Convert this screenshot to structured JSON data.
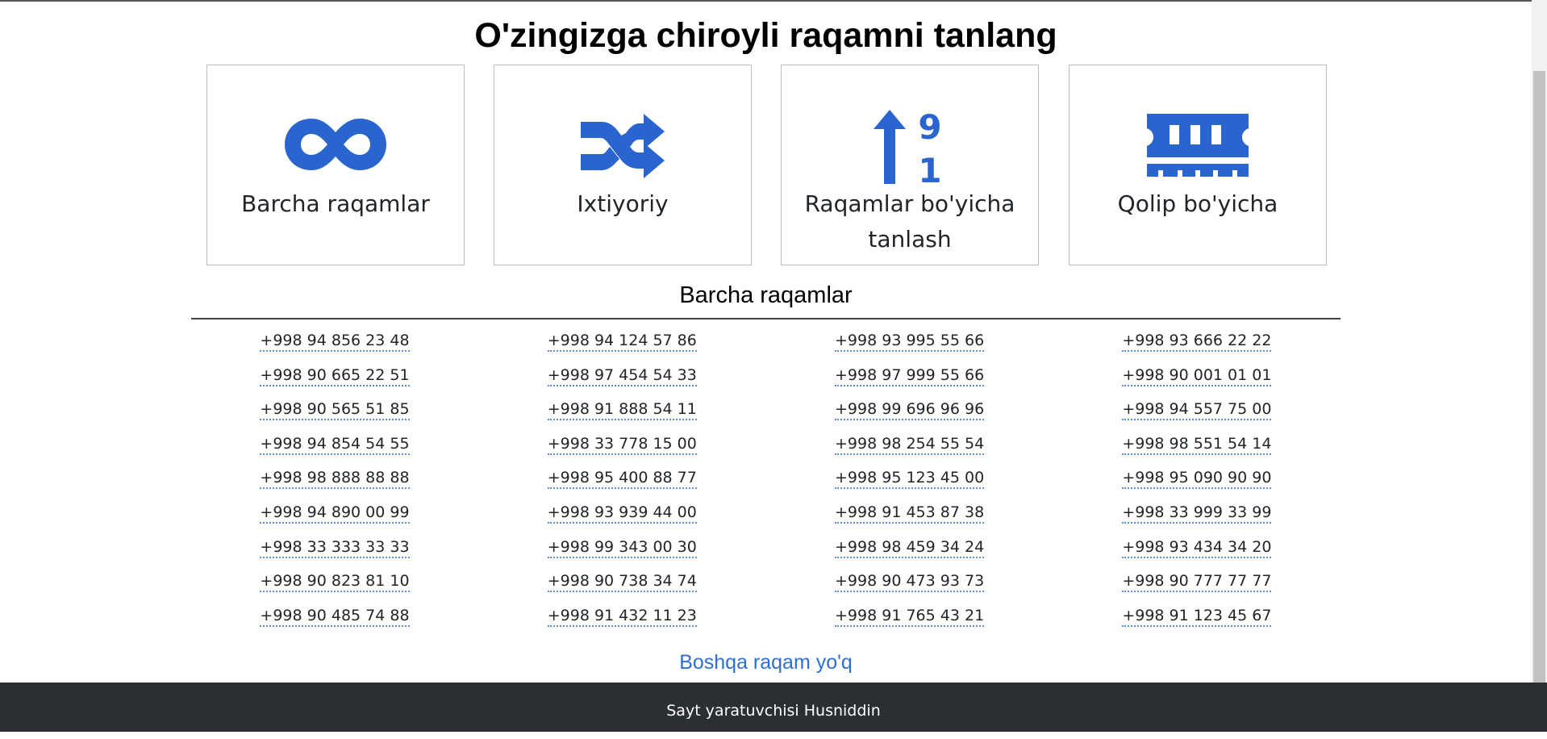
{
  "page": {
    "title": "O'zingizga chiroyli raqamni tanlang",
    "section_title": "Barcha raqamlar",
    "more_label": "Boshqa raqam yo'q",
    "footer_text": "Sayt yaratuvchisi Husniddin"
  },
  "colors": {
    "accent": "#2a65cf",
    "footer_bg": "#2b2e33",
    "link": "#2f6fd1"
  },
  "cards": [
    {
      "icon": "infinity-icon",
      "label": "Barcha raqamlar"
    },
    {
      "icon": "shuffle-icon",
      "label": "Ixtiyoriy"
    },
    {
      "icon": "sort-numeric-up-icon",
      "label": "Raqamlar bo'yicha tanlash"
    },
    {
      "icon": "memory-icon",
      "label": "Qolip bo'yicha"
    }
  ],
  "numbers": [
    [
      "+998 94 856 23 48",
      "+998 90 665 22 51",
      "+998 90 565 51 85",
      "+998 94 854 54 55",
      "+998 98 888 88 88",
      "+998 94 890 00 99",
      "+998 33 333 33 33",
      "+998 90 823 81 10",
      "+998 90 485 74 88"
    ],
    [
      "+998 94 124 57 86",
      "+998 97 454 54 33",
      "+998 91 888 54 11",
      "+998 33 778 15 00",
      "+998 95 400 88 77",
      "+998 93 939 44 00",
      "+998 99 343 00 30",
      "+998 90 738 34 74",
      "+998 91 432 11 23"
    ],
    [
      "+998 93 995 55 66",
      "+998 97 999 55 66",
      "+998 99 696 96 96",
      "+998 98 254 55 54",
      "+998 95 123 45 00",
      "+998 91 453 87 38",
      "+998 98 459 34 24",
      "+998 90 473 93 73",
      "+998 91 765 43 21"
    ],
    [
      "+998 93 666 22 22",
      "+998 90 001 01 01",
      "+998 94 557 75 00",
      "+998 98 551 54 14",
      "+998 95 090 90 90",
      "+998 33 999 33 99",
      "+998 93 434 34 20",
      "+998 90 777 77 77",
      "+998 91 123 45 67"
    ]
  ]
}
